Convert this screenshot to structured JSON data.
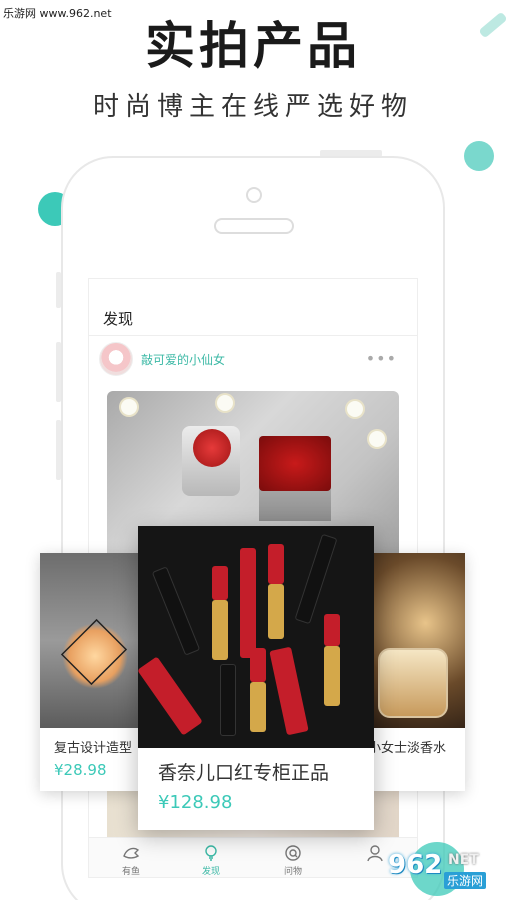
{
  "watermark": "乐游网 www.962.net",
  "headline": "实拍产品",
  "subheadline": "时尚博主在线严选好物",
  "screen": {
    "title": "发现",
    "username": "敲可爱的小仙女",
    "more": "•••",
    "tabs": [
      {
        "label": "有鱼",
        "icon": "fish-icon",
        "active": false
      },
      {
        "label": "发现",
        "icon": "lightbulb-icon",
        "active": true
      },
      {
        "label": "问物",
        "icon": "search-question-icon",
        "active": false
      },
      {
        "label": "",
        "icon": "profile-icon",
        "active": false
      }
    ]
  },
  "cards": {
    "left": {
      "title": "复古设计造型",
      "price": "¥28.98"
    },
    "center": {
      "title": "香奈儿口红专柜正品",
      "price": "¥128.98"
    },
    "right": {
      "title": "小女士淡香水"
    }
  },
  "badge": {
    "num": "962",
    "net": "NET",
    "cn": "乐游网"
  },
  "colors": {
    "accent": "#3cc9b8",
    "price": "#3cc9b8"
  }
}
